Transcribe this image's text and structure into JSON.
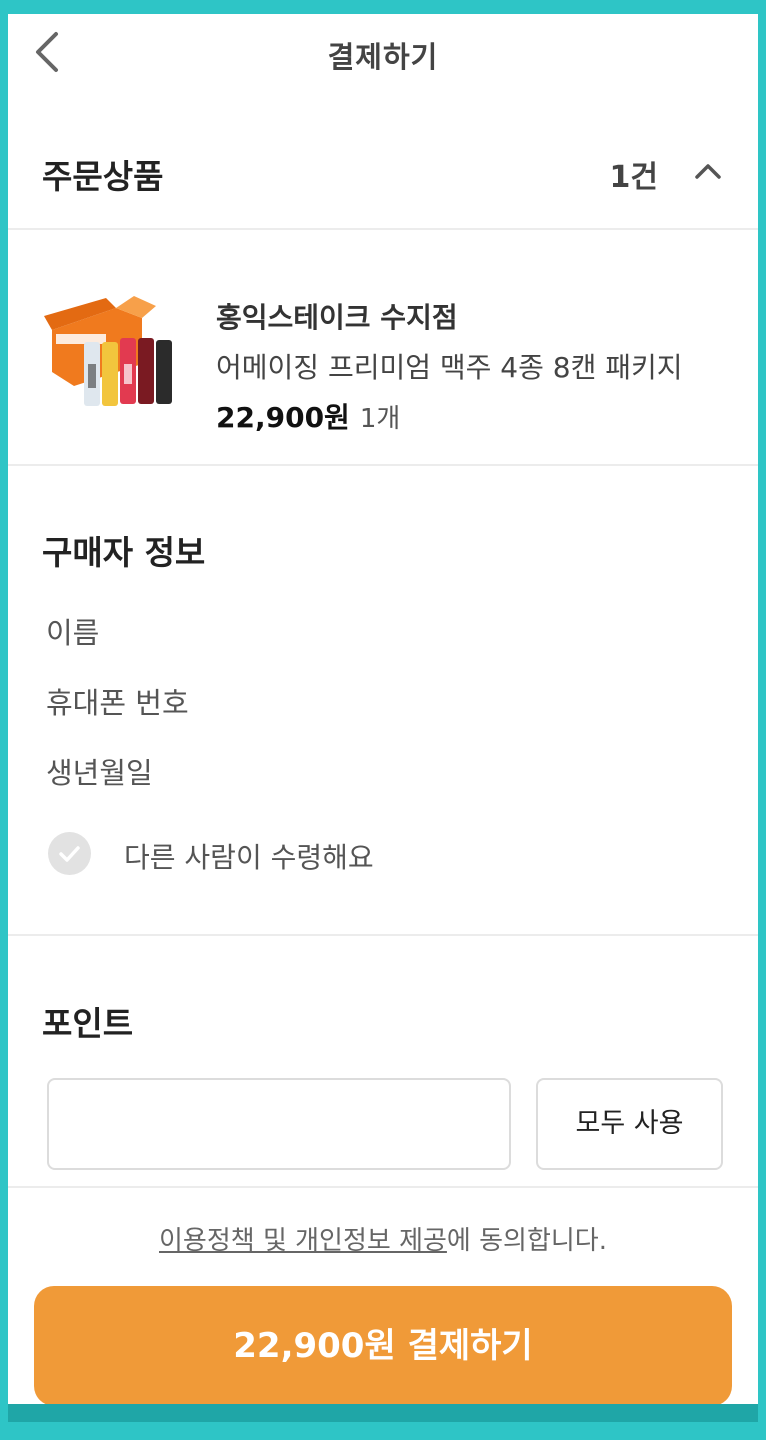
{
  "header": {
    "title": "결제하기",
    "back_icon": "chevron-left-icon"
  },
  "order": {
    "section_title": "주문상품",
    "count": "1건",
    "collapse_icon": "chevron-up-icon",
    "item": {
      "store": "홍익스테이크 수지점",
      "name": "어메이징 프리미엄 맥주 4종 8캔 패키지",
      "price": "22,900원",
      "quantity": "1개"
    }
  },
  "buyer": {
    "section_title": "구매자 정보",
    "fields": [
      "이름",
      "휴대폰 번호",
      "생년월일"
    ],
    "other_receiver_label": "다른 사람이 수령해요",
    "other_receiver_checked": false
  },
  "point": {
    "section_title": "포인트",
    "input_value": "",
    "use_all_label": "모두 사용"
  },
  "agreement": {
    "link_text": "이용정책 및 개인정보 제공",
    "suffix": "에 동의합니다."
  },
  "pay_button": {
    "label": "22,900원 결제하기"
  },
  "colors": {
    "accent": "#f09a38",
    "frame": "#2ec5c6",
    "divider": "#ececec"
  }
}
